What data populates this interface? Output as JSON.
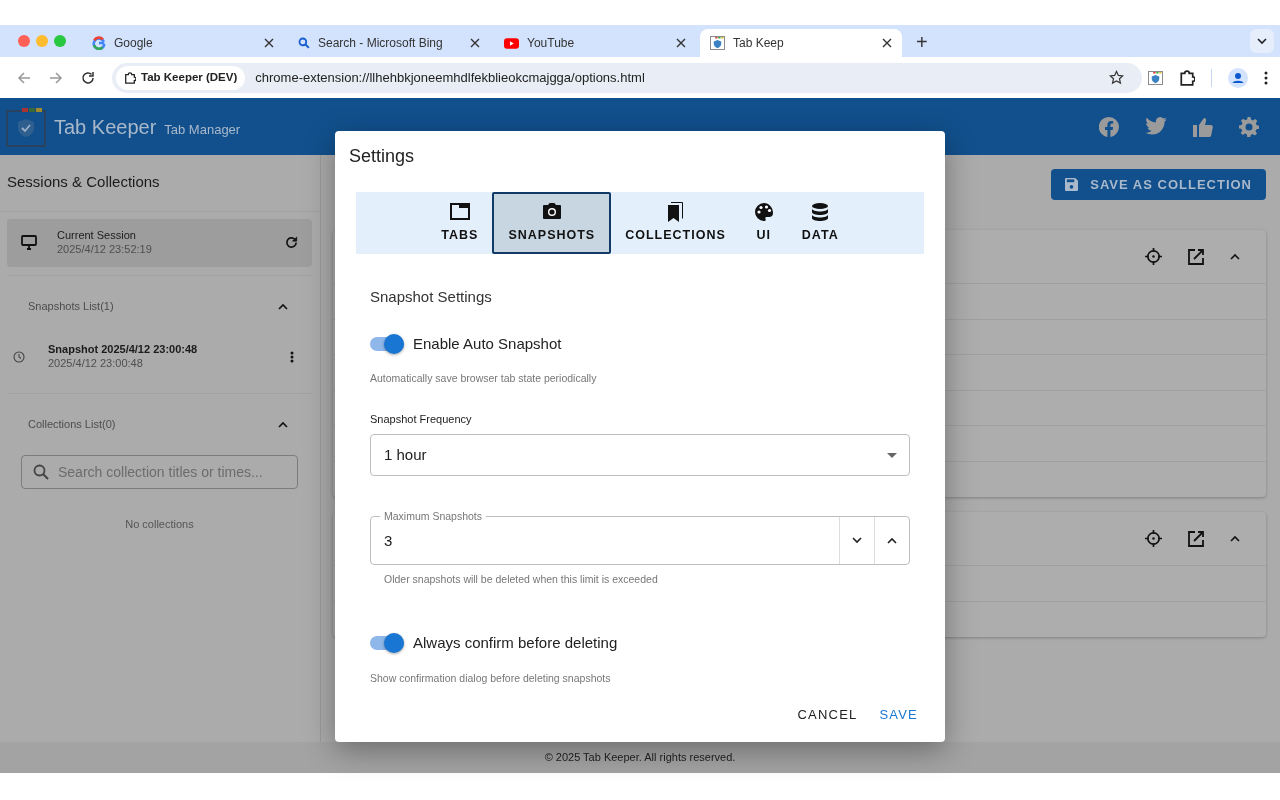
{
  "browser": {
    "tabs": [
      {
        "title": "Google",
        "selected": false
      },
      {
        "title": "Search - Microsoft Bing",
        "selected": false
      },
      {
        "title": "YouTube",
        "selected": false
      },
      {
        "title": "Tab Keep",
        "selected": true
      }
    ],
    "new_tab": "+",
    "address": {
      "chip": "Tab Keeper (DEV)",
      "url": "chrome-extension://llhehbkjoneemhdlfekblieokcmajgga/options.html"
    }
  },
  "app": {
    "brand": "Tab Keeper",
    "subtitle": "Tab Manager"
  },
  "sidebar": {
    "title": "Sessions & Collections",
    "current_session": {
      "title": "Current Session",
      "time": "2025/4/12 23:52:19"
    },
    "snapshots": {
      "title": "Snapshots List(1)",
      "expanded": true,
      "items": [
        {
          "title": "Snapshot 2025/4/12 23:00:48",
          "time": "2025/4/12 23:00:48"
        }
      ]
    },
    "collections": {
      "title": "Collections List(0)",
      "expanded": true,
      "search": {
        "placeholder": "Search collection titles or times..."
      },
      "empty": "No collections"
    }
  },
  "main": {
    "save_button": "SAVE AS COLLECTION",
    "cards": [
      {
        "expanded": true
      },
      {
        "expanded": true
      }
    ]
  },
  "dialog": {
    "title": "Settings",
    "tabs": [
      {
        "label": "TABS",
        "selected": false
      },
      {
        "label": "SNAPSHOTS",
        "selected": true
      },
      {
        "label": "COLLECTIONS",
        "selected": false
      },
      {
        "label": "UI",
        "selected": false
      },
      {
        "label": "DATA",
        "selected": false
      }
    ],
    "section_title": "Snapshot Settings",
    "fields": [
      {
        "kind": "toggle",
        "label": "Enable Auto Snapshot",
        "on": true,
        "help": "Automatically save browser tab state periodically"
      },
      {
        "kind": "select",
        "label": "Snapshot Frequency",
        "value": "1 hour"
      },
      {
        "kind": "number",
        "label": "Maximum Snapshots",
        "value": "3",
        "help": "Older snapshots will be deleted when this limit is exceeded"
      },
      {
        "kind": "toggle",
        "label": "Always confirm before deleting",
        "on": true,
        "help": "Show confirmation dialog before deleting snapshots"
      }
    ],
    "actions": [
      {
        "label": "CANCEL",
        "primary": false
      },
      {
        "label": "SAVE",
        "primary": true
      }
    ]
  },
  "footer": "© 2025 Tab Keeper. All rights reserved."
}
